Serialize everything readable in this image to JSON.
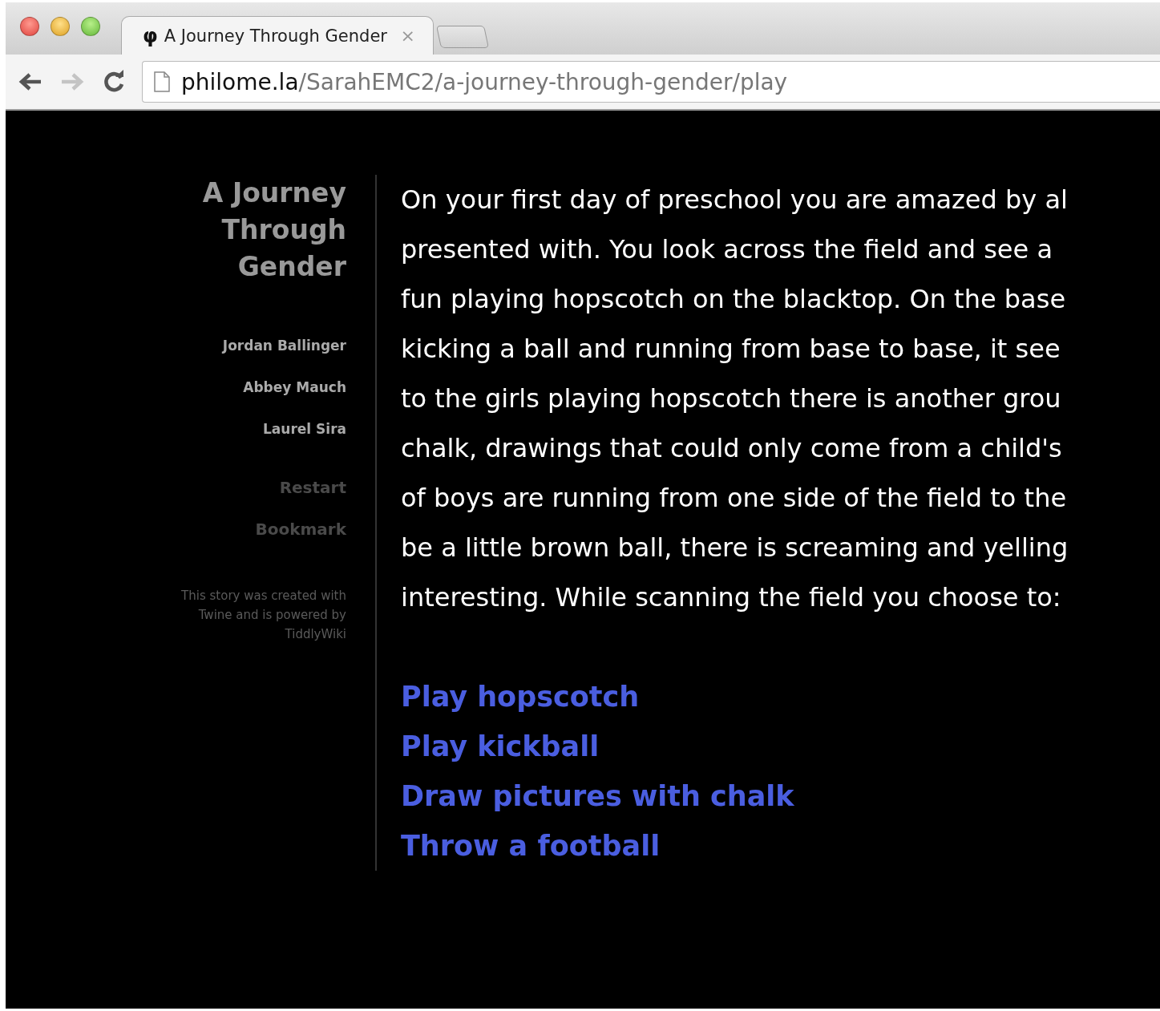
{
  "tabs": [
    {
      "favicon": "φ",
      "title": "A Journey Through Gender",
      "close": "×",
      "selected": true
    }
  ],
  "nav": {
    "back_enabled": true,
    "forward_enabled": false
  },
  "address": {
    "host": "philome.la",
    "path": "/SarahEMC2/a-journey-through-gender/play"
  },
  "sidebar": {
    "title": "A Journey Through Gender",
    "authors": [
      "Jordan Ballinger",
      "Abbey Mauch",
      "Laurel Sira"
    ],
    "menu": [
      "Restart",
      "Bookmark"
    ],
    "credit": "This story was created with Twine and is powered by TiddlyWiki"
  },
  "passage": {
    "lines": [
      "On your first day of preschool you are amazed by al",
      "presented with. You look across the field and see a",
      "fun playing hopscotch on the blacktop. On the base",
      "kicking a ball and running from base to base, it see",
      "to the girls playing hopscotch there is another grou",
      "chalk, drawings that could only come from a child's",
      "of boys are running from one side of the field to the",
      "be a little brown ball, there is screaming and yelling",
      "interesting. While scanning the field you choose to:"
    ],
    "choices": [
      "Play hopscotch",
      "Play kickball",
      "Draw pictures with chalk",
      "Throw a football"
    ]
  }
}
